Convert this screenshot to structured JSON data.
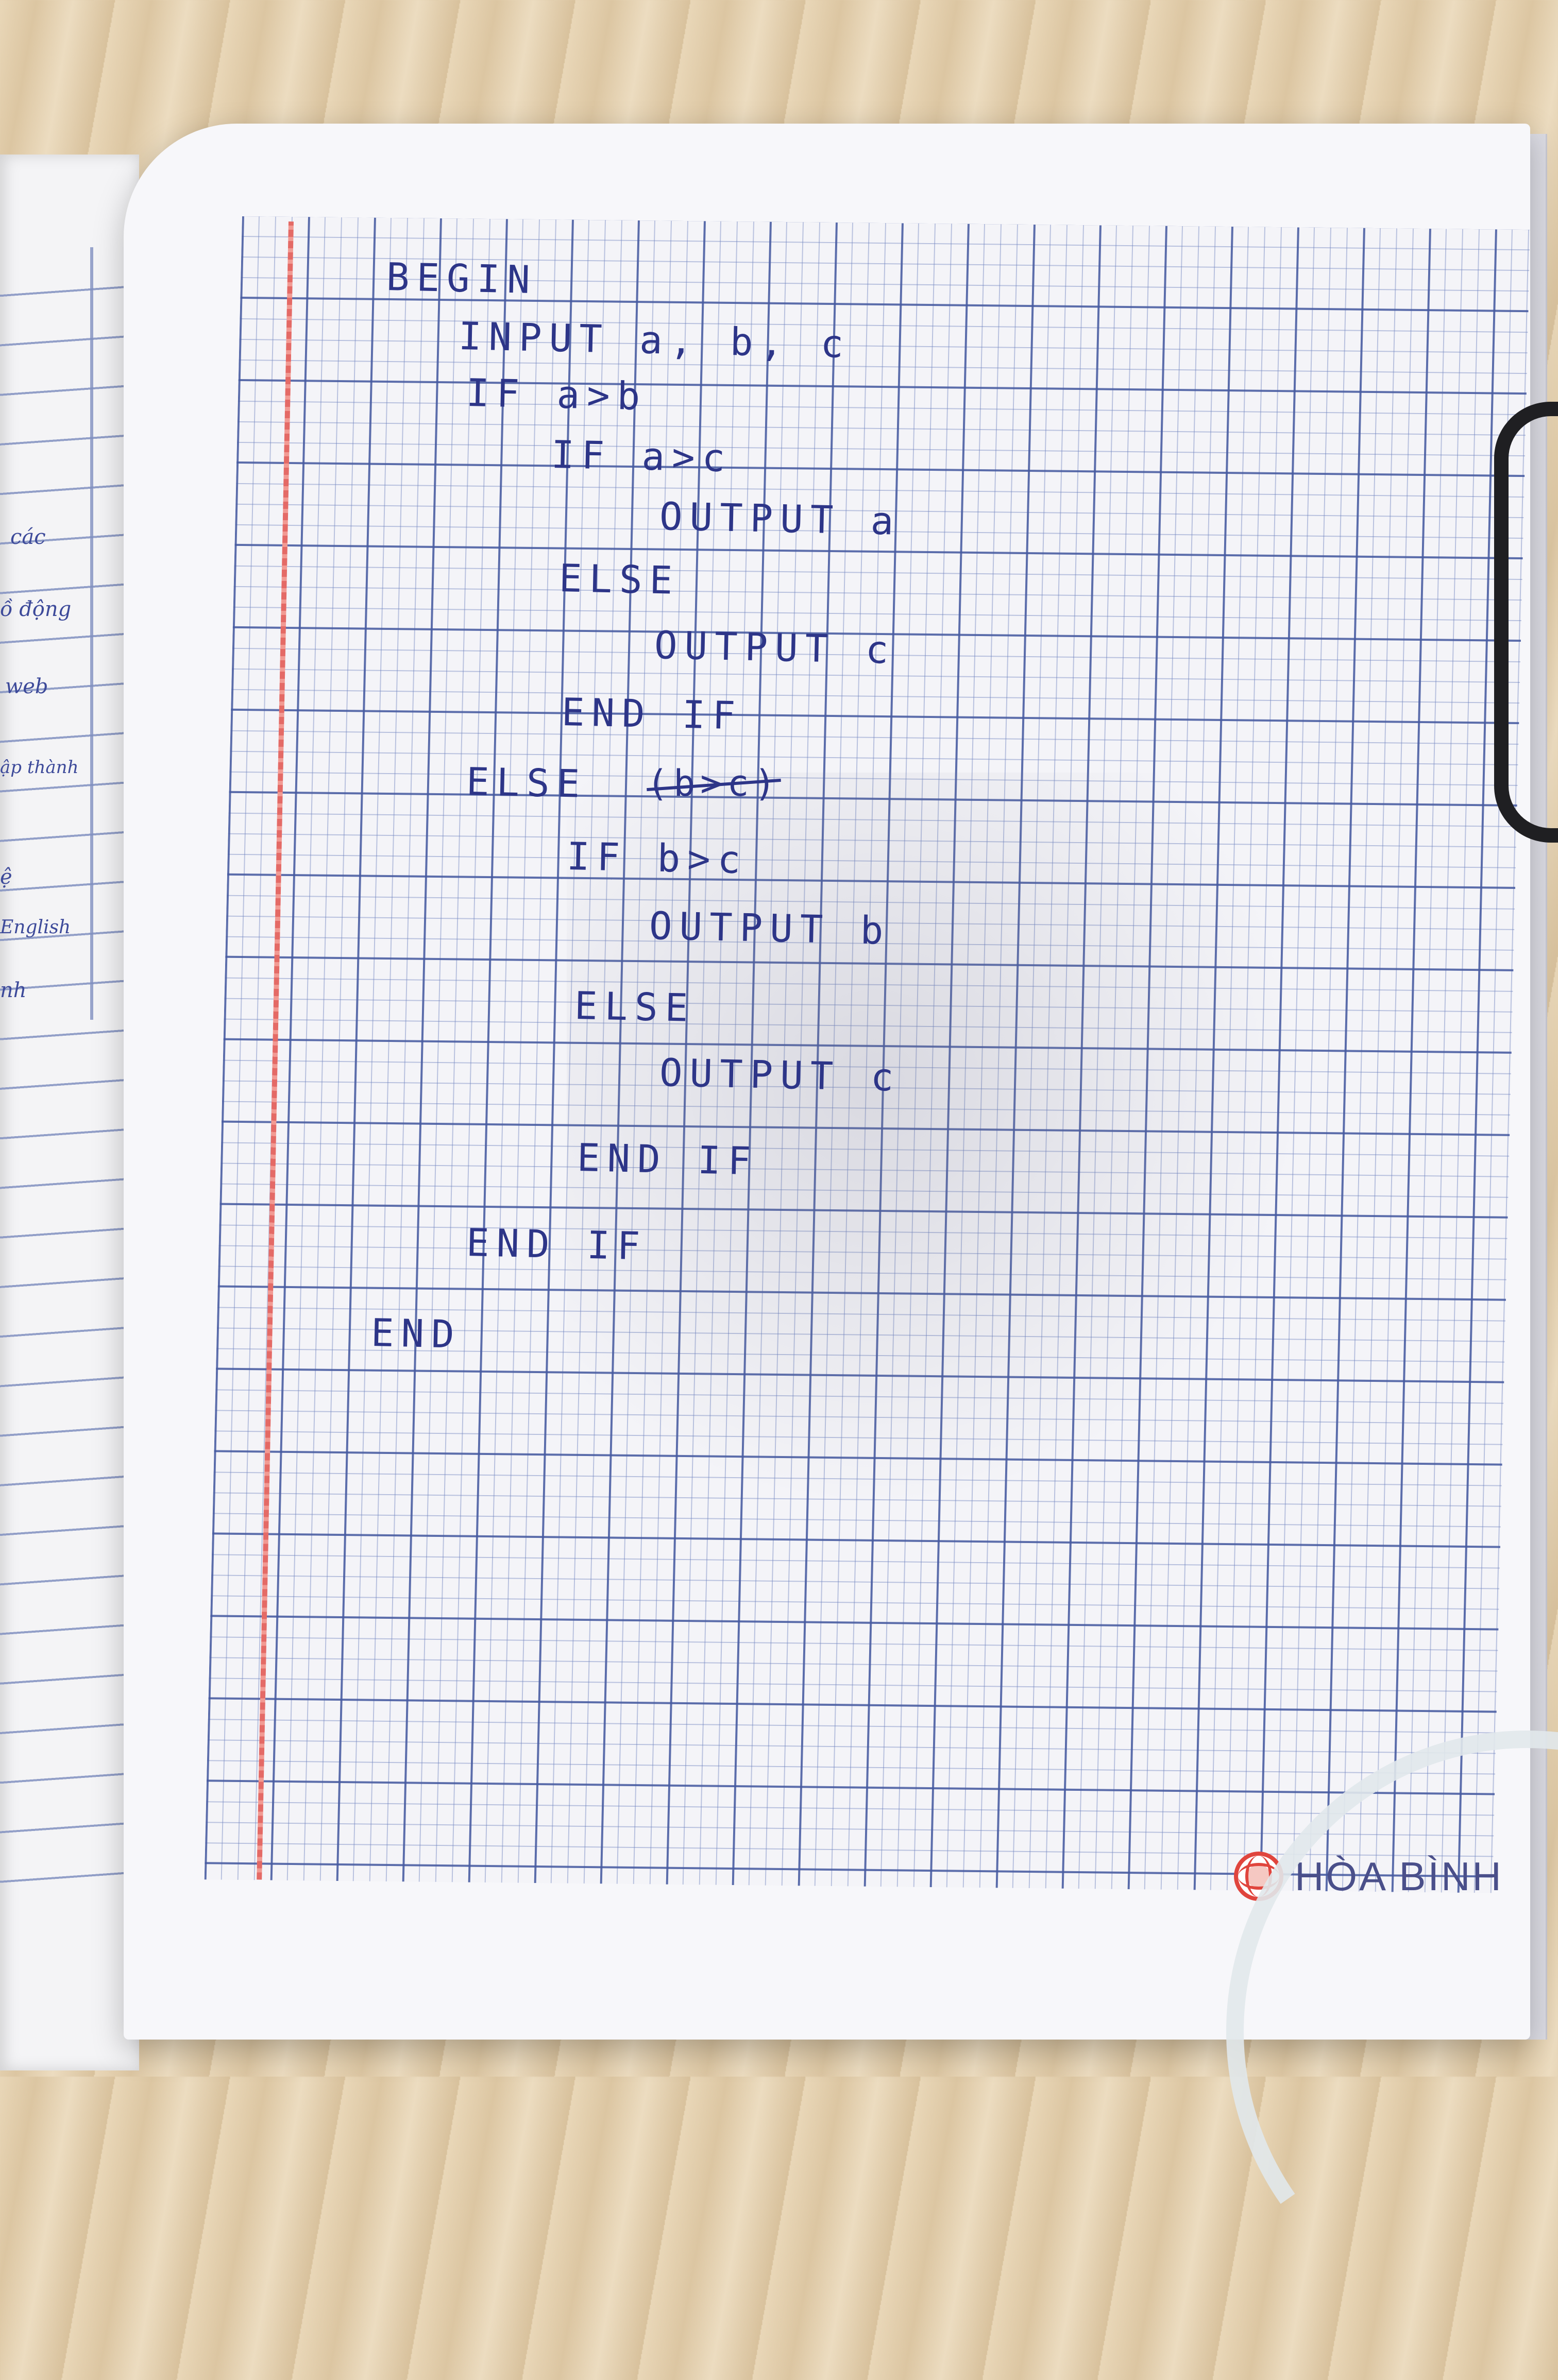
{
  "left_page": {
    "notes": [
      "các",
      "ồ động",
      "web",
      "ập thành",
      "ệ",
      "English",
      "nh"
    ]
  },
  "code": {
    "lines": [
      "BEGIN",
      "INPUT a, b, c",
      "IF a>b",
      "IF a>c",
      "OUTPUT a",
      "ELSE",
      "OUTPUT c",
      "END IF",
      "ELSE",
      "IF b>c",
      "OUTPUT b",
      "ELSE",
      "OUTPUT c",
      "END IF",
      "END IF",
      "END"
    ],
    "struck_text": "(b>c)"
  },
  "brand": {
    "text": "HÒA BÌNH"
  },
  "colors": {
    "ink": "#2d3588",
    "grid": "#465aa0",
    "margin": "#e46a66",
    "logo": "#e0453d"
  }
}
